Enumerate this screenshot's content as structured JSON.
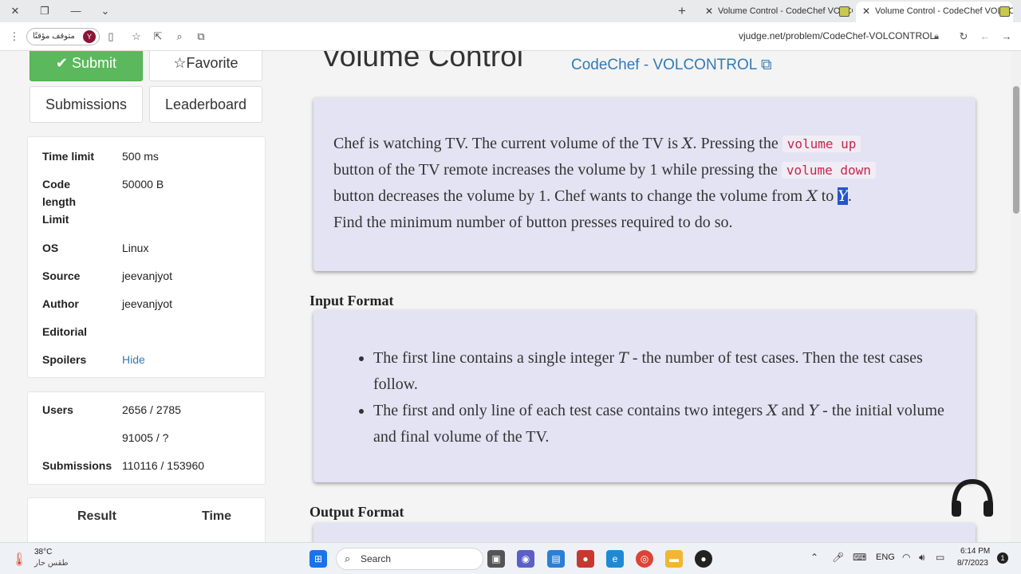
{
  "browser": {
    "tabs": [
      {
        "title": "Volume Control - CodeChef VOLCONTROL"
      },
      {
        "title": "Volume Control - CodeChef VOLCONTROL"
      }
    ],
    "profile_label": "متوقف مؤقتًا",
    "profile_initial": "Y",
    "url": "vjudge.net/problem/CodeChef-VOLCONTROL"
  },
  "sidebar": {
    "submit_label": "Submit",
    "favorite_label": "Favorite",
    "submissions_label": "Submissions",
    "leaderboard_label": "Leaderboard",
    "info": [
      {
        "key": "Time limit",
        "value": "500 ms"
      },
      {
        "key": "Code length Limit",
        "value": "50000 B"
      },
      {
        "key": "OS",
        "value": "Linux"
      },
      {
        "key": "Source",
        "value": "jeevanjyot"
      },
      {
        "key": "Author",
        "value": "jeevanjyot"
      },
      {
        "key": "Editorial",
        "value": ""
      },
      {
        "key": "Spoilers",
        "value": "Hide"
      }
    ],
    "stats": [
      {
        "key": "Users",
        "value": "2656 / 2785"
      },
      {
        "key": "",
        "value": "91005 / ?"
      },
      {
        "key": "Submissions",
        "value": "110116 / 153960"
      }
    ],
    "result_header": "Result",
    "time_header": "Time"
  },
  "problem": {
    "title": "Volume Control",
    "source_link": "CodeChef - VOLCONTROL",
    "statement": {
      "p1": "Chef is watching TV. The current volume of the TV is ",
      "var_x": "X",
      "p2": ". Pressing the ",
      "code_up": "volume up",
      "p3": "button of the TV remote increases the volume by 1 while pressing the ",
      "code_down": "volume down",
      "p4": "button decreases the volume by 1. Chef wants to change the volume from ",
      "var_x2": "X",
      "p5": " to ",
      "var_y": "Y",
      "p6": ".",
      "p7": "Find the minimum number of button presses required to do so."
    },
    "input_format_heading": "Input Format",
    "input_bullets": {
      "b1a": "The first line contains a single integer ",
      "b1var": "T",
      "b1b": " - the number of test cases. Then the test cases follow.",
      "b2a": "The first and only line of each test case contains two integers ",
      "b2x": "X",
      "b2and": " and ",
      "b2y": "Y",
      "b2b": " - the initial volume and final volume of the TV."
    },
    "output_format_heading": "Output Format"
  },
  "taskbar": {
    "weather_temp": "38°C",
    "weather_desc": "طقس حار",
    "search_label": "Search",
    "lang": "ENG",
    "time": "6:14 PM",
    "date": "8/7/2023",
    "notif_count": "1"
  },
  "colors": {
    "accent_link": "#337ab7",
    "submit_green": "#5cb85c",
    "panel_bg": "#e3e3f4"
  }
}
